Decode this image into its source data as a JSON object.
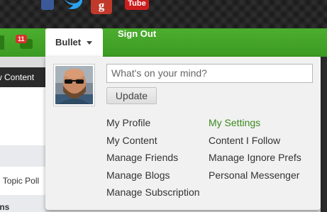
{
  "social": {
    "googleplus_glyph": "g",
    "youtube_glyph": "Tube"
  },
  "nav": {
    "notification_count": "11",
    "user_menu_label": "Bullet",
    "signout_label": "Sign Out"
  },
  "background_page": {
    "sidebar_tab_label": "w Content",
    "sidebar_poll_label": "e Topic Poll",
    "sidebar_heading": "ons"
  },
  "dropdown": {
    "status_placeholder": "What's on your mind?",
    "update_button": "Update",
    "menu_left": [
      {
        "label": "My Profile"
      },
      {
        "label": "My Content"
      },
      {
        "label": "Manage Friends"
      },
      {
        "label": "Manage Blogs"
      },
      {
        "label": "Manage Subscription"
      }
    ],
    "menu_right": [
      {
        "label": "My Settings",
        "active": true
      },
      {
        "label": "Content I Follow"
      },
      {
        "label": "Manage Ignore Prefs"
      },
      {
        "label": "Personal Messenger"
      }
    ]
  },
  "colors": {
    "nav_green": "#3f9f26",
    "active_link_green": "#3c8a1e",
    "badge_red": "#d9302a"
  }
}
